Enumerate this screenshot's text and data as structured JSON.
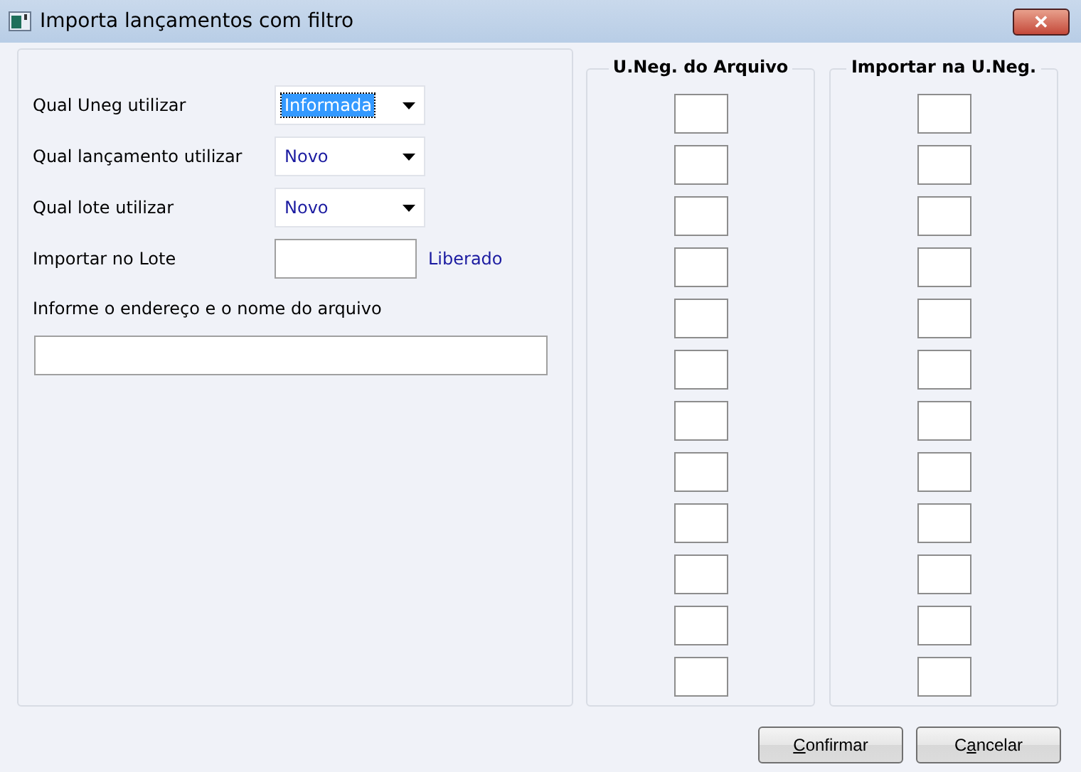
{
  "window": {
    "title": "Importa lançamentos com filtro",
    "close_label": "✕"
  },
  "form": {
    "rows": [
      {
        "kind": "combo",
        "label": "Qual Uneg utilizar",
        "value": "Informada",
        "focused": true
      },
      {
        "kind": "combo",
        "label": "Qual lançamento utilizar",
        "value": "Novo",
        "focused": false
      },
      {
        "kind": "combo",
        "label": "Qual lote utilizar",
        "value": "Novo",
        "focused": false
      },
      {
        "kind": "field",
        "label": "Importar no Lote",
        "status": "Liberado"
      }
    ],
    "file_label": "Informe o endereço e o nome do arquivo"
  },
  "groups": [
    {
      "title": "U.Neg. do Arquivo"
    },
    {
      "title": "Importar na U.Neg."
    }
  ],
  "buttons": [
    {
      "mnemonic": "C",
      "rest": "onfirmar"
    },
    {
      "before": "C",
      "mnemonic": "a",
      "rest": "ncelar"
    }
  ]
}
